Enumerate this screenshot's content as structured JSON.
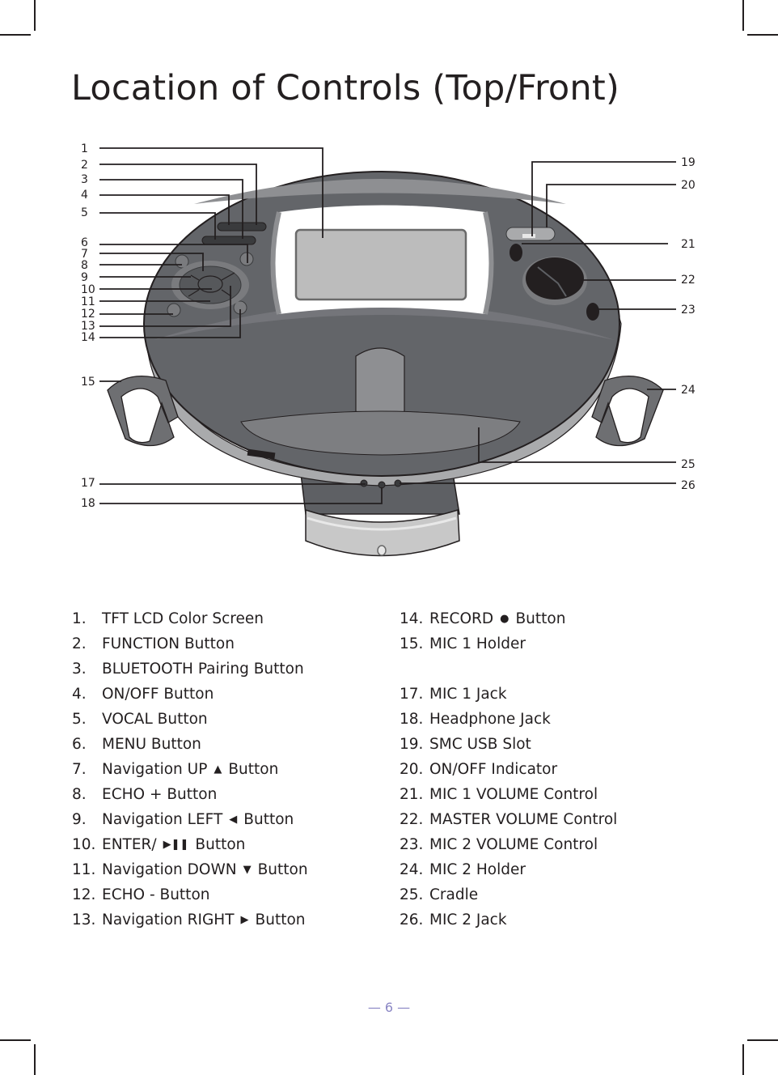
{
  "page": {
    "title": "Location of Controls (Top/Front)",
    "page_number_label": "— 6 —"
  },
  "diagram": {
    "callouts_left": [
      "1",
      "2",
      "3",
      "4",
      "5",
      "6",
      "7",
      "8",
      "9",
      "10",
      "11",
      "12",
      "13",
      "14",
      "15",
      "17",
      "18"
    ],
    "callouts_right": [
      "19",
      "20",
      "21",
      "22",
      "23",
      "24",
      "25",
      "26"
    ]
  },
  "controls": {
    "left_column": [
      {
        "num": "1.",
        "label": "TFT LCD Color Screen"
      },
      {
        "num": "2.",
        "label": "FUNCTION Button"
      },
      {
        "num": "3.",
        "label": "BLUETOOTH Pairing Button"
      },
      {
        "num": "4.",
        "label": "ON/OFF Button"
      },
      {
        "num": "5.",
        "label": "VOCAL Button"
      },
      {
        "num": "6.",
        "label": "MENU Button"
      },
      {
        "num": "7.",
        "label": "Navigation UP",
        "glyph": "▲",
        "suffix": "Button"
      },
      {
        "num": "8.",
        "label": "ECHO + Button"
      },
      {
        "num": "9.",
        "label": "Navigation LEFT",
        "glyph": "◀",
        "suffix": "Button"
      },
      {
        "num": "10.",
        "label": "ENTER/",
        "glyph": "▶❚❚",
        "suffix": "Button"
      },
      {
        "num": "11.",
        "label": "Navigation DOWN",
        "glyph": "▼",
        "suffix": "Button"
      },
      {
        "num": "12.",
        "label": "ECHO - Button"
      },
      {
        "num": "13.",
        "label": "Navigation RIGHT",
        "glyph": "▶",
        "suffix": "Button"
      }
    ],
    "right_column": [
      {
        "num": "14.",
        "label": "RECORD",
        "glyph": "●",
        "suffix": "Button"
      },
      {
        "num": "15.",
        "label": "MIC 1 Holder"
      },
      {
        "num": "",
        "label": ""
      },
      {
        "num": "17.",
        "label": "MIC 1 Jack"
      },
      {
        "num": "18.",
        "label": "Headphone Jack"
      },
      {
        "num": "19.",
        "label": "SMC USB Slot"
      },
      {
        "num": "20.",
        "label": "ON/OFF Indicator"
      },
      {
        "num": "21.",
        "label": "MIC 1 VOLUME Control"
      },
      {
        "num": "22.",
        "label": "MASTER VOLUME Control"
      },
      {
        "num": "23.",
        "label": "MIC 2 VOLUME Control"
      },
      {
        "num": "24.",
        "label": "MIC 2 Holder"
      },
      {
        "num": "25.",
        "label": "Cradle"
      },
      {
        "num": "26.",
        "label": "MIC 2 Jack"
      }
    ]
  },
  "colors": {
    "text": "#231f20",
    "body_dark": "#636569",
    "body_light": "#8e8f92",
    "screen": "#bcbcbc",
    "footer": "#8a86c4"
  }
}
